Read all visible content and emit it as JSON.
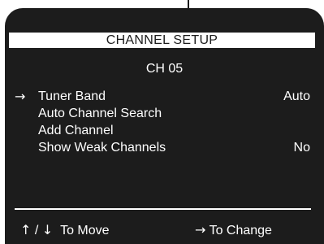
{
  "screen": {
    "title": "CHANNEL SETUP",
    "channel": "CH 05"
  },
  "menu": {
    "cursor_icon": "→",
    "items": [
      {
        "label": "Tuner Band",
        "value": "Auto",
        "selected": true
      },
      {
        "label": "Auto Channel Search",
        "value": "",
        "selected": false
      },
      {
        "label": "Add Channel",
        "value": "",
        "selected": false
      },
      {
        "label": "Show Weak Channels",
        "value": "No",
        "selected": false
      }
    ]
  },
  "footer": {
    "up_icon": "↑",
    "separator": "/",
    "down_icon": "↓",
    "move_label": "To Move",
    "right_icon": "→",
    "change_label": "To Change"
  },
  "colors": {
    "background": "#1c1c1c",
    "text": "#ffffff",
    "title_bar": "#ffffff"
  }
}
